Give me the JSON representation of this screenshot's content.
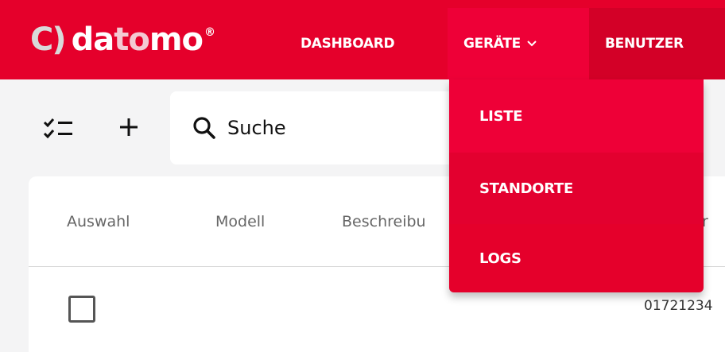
{
  "brand": {
    "mark": "C)",
    "word_a": "da",
    "word_b": "to",
    "word_c": "mo",
    "registered": "®"
  },
  "nav": {
    "dashboard": "DASHBOARD",
    "geraete": "GERÄTE",
    "benutzer": "BENUTZER"
  },
  "dropdown": {
    "items": [
      {
        "label": "LISTE",
        "active": true
      },
      {
        "label": "STANDORTE",
        "active": false
      },
      {
        "label": "LOGS",
        "active": false
      }
    ]
  },
  "toolbar": {
    "checklist_icon": "checklist-icon",
    "add_icon": "plus-icon"
  },
  "search": {
    "placeholder": "Suche",
    "value": ""
  },
  "table": {
    "headers": [
      "Auswahl",
      "Modell",
      "Beschreibu",
      "nr"
    ],
    "rows": [
      {
        "number": "01721234"
      }
    ]
  },
  "colors": {
    "brand_red": "#e5002b",
    "active_red": "#ee0037",
    "background": "#f4f4f5"
  }
}
